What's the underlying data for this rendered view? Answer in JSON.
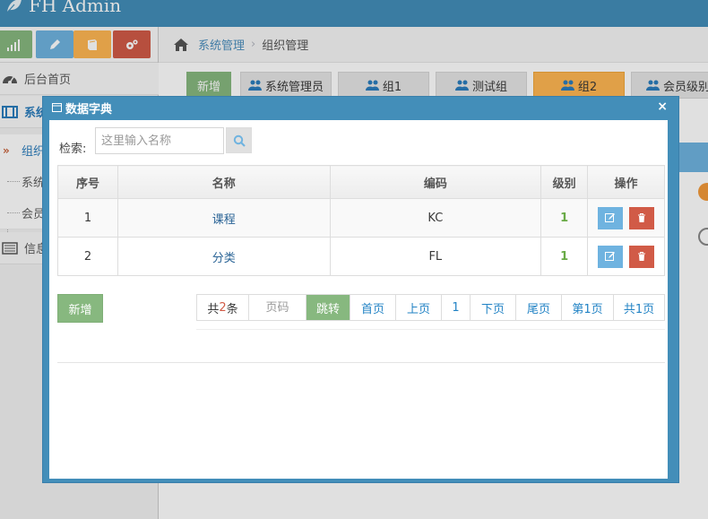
{
  "app": {
    "brand": "FH Admin"
  },
  "colors": {
    "navbar": "#438eb9",
    "green": "#87b87f",
    "blue": "#6fb3e0",
    "yellow": "#ffb752",
    "red": "#d15b47"
  },
  "sidebar": {
    "shortcuts": [
      {
        "icon": "signal-icon",
        "color": "#87b87f"
      },
      {
        "icon": "pencil-icon",
        "color": "#6fb3e0"
      },
      {
        "icon": "book-icon",
        "color": "#ffb752"
      },
      {
        "icon": "cogs-icon",
        "color": "#d15b47"
      }
    ],
    "items": [
      {
        "label": "后台首页",
        "icon": "dashboard-icon"
      },
      {
        "label": "系统",
        "icon": "film-icon"
      },
      {
        "label": "信息",
        "icon": "list-icon"
      }
    ],
    "subitems": [
      {
        "label": "组织"
      },
      {
        "label": "系统"
      },
      {
        "label": "会员"
      }
    ]
  },
  "breadcrumb": {
    "link": "系统管理",
    "current": "组织管理"
  },
  "tabs": [
    {
      "label": "新增"
    },
    {
      "label": "系统管理员"
    },
    {
      "label": "组1"
    },
    {
      "label": "测试组"
    },
    {
      "label": "组2"
    },
    {
      "label": "会员级别"
    }
  ],
  "dialog": {
    "title": "数据字典",
    "close": "×",
    "search_label": "检索:",
    "search_placeholder": "这里输入名称",
    "table": {
      "headers": [
        "序号",
        "名称",
        "编码",
        "级别",
        "操作"
      ],
      "rows": [
        {
          "index": "1",
          "name": "课程",
          "code": "KC",
          "level": "1"
        },
        {
          "index": "2",
          "name": "分类",
          "code": "FL",
          "level": "1"
        }
      ]
    },
    "add_label": "新增",
    "pager": {
      "total_prefix": "共",
      "total_count": "2",
      "total_suffix": "条",
      "page_placeholder": "页码",
      "jump": "跳转",
      "first": "首页",
      "prev": "上页",
      "current": "1",
      "next": "下页",
      "last": "尾页",
      "page_of": "第1页",
      "page_total": "共1页"
    }
  }
}
